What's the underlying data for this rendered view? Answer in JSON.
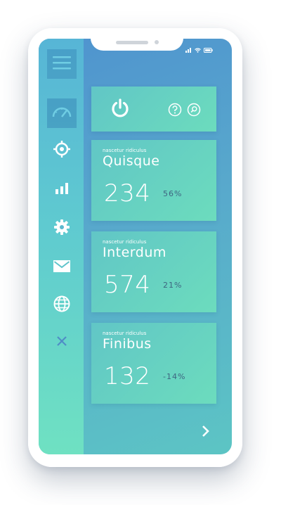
{
  "sidebar": {
    "items": [
      {
        "name": "menu",
        "icon": "hamburger-icon"
      },
      {
        "name": "dashboard",
        "icon": "speedometer-icon",
        "active": true
      },
      {
        "name": "target",
        "icon": "crosshair-icon"
      },
      {
        "name": "stats",
        "icon": "bar-chart-icon"
      },
      {
        "name": "settings",
        "icon": "gear-icon"
      },
      {
        "name": "mail",
        "icon": "envelope-icon"
      },
      {
        "name": "web",
        "icon": "globe-icon"
      },
      {
        "name": "close",
        "icon": "close-icon"
      }
    ]
  },
  "header": {
    "power_icon": "power-icon",
    "help_icon": "help-icon",
    "search_icon": "search-icon"
  },
  "cards": [
    {
      "subtitle": "nascetur ridiculus",
      "title": "Quisque",
      "value": "234",
      "change": "56%"
    },
    {
      "subtitle": "nascetur ridiculus",
      "title": "Interdum",
      "value": "574",
      "change": "21%"
    },
    {
      "subtitle": "nascetur ridiculus",
      "title": "Finibus",
      "value": "132",
      "change": "-14%"
    }
  ],
  "footer": {
    "next_icon": "chevron-right-icon"
  },
  "colors": {
    "accent_dark": "#3e6580",
    "card_start": "#61c6c6",
    "card_end": "#6cdcbd",
    "sidebar_top": "#57b5d6",
    "sidebar_bottom": "#6fe1c2"
  }
}
